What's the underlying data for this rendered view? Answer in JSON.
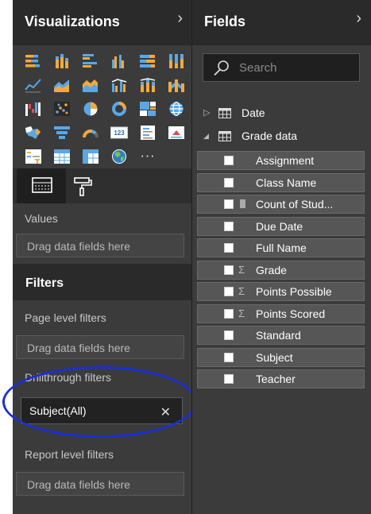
{
  "visualizations": {
    "title": "Visualizations",
    "expand_icon": "chevron-right-icon",
    "more_label": "···",
    "tabs": [
      {
        "name": "fields-tab",
        "icon": "fields-well-icon",
        "selected": true
      },
      {
        "name": "format-tab",
        "icon": "paint-roller-icon",
        "selected": false
      }
    ],
    "values_label": "Values",
    "values_placeholder": "Drag data fields here"
  },
  "filters": {
    "title": "Filters",
    "page_level_label": "Page level filters",
    "page_level_placeholder": "Drag data fields here",
    "drillthrough_label": "Drillthrough filters",
    "drillthrough_filter": {
      "label": "Subject(All)",
      "close_icon": "close-icon"
    },
    "report_level_label": "Report level filters",
    "report_level_placeholder": "Drag data fields here"
  },
  "fields": {
    "title": "Fields",
    "expand_icon": "chevron-right-icon",
    "search_placeholder": "Search",
    "tables": [
      {
        "name": "Date",
        "expanded": false
      },
      {
        "name": "Grade data",
        "expanded": true
      }
    ],
    "items": [
      {
        "name": "Assignment",
        "type": "text"
      },
      {
        "name": "Class Name",
        "type": "text"
      },
      {
        "name": "Count of Stud...",
        "type": "measure"
      },
      {
        "name": "Due Date",
        "type": "text"
      },
      {
        "name": "Full Name",
        "type": "text"
      },
      {
        "name": "Grade",
        "type": "sum"
      },
      {
        "name": "Points Possible",
        "type": "sum"
      },
      {
        "name": "Points Scored",
        "type": "sum"
      },
      {
        "name": "Standard",
        "type": "text"
      },
      {
        "name": "Subject",
        "type": "text"
      },
      {
        "name": "Teacher",
        "type": "text"
      }
    ]
  },
  "colors": {
    "annotation": "#1b2fd6",
    "orange": "#f2a93b",
    "blue": "#5aa7e6",
    "pane_bg": "#3b3b3b"
  }
}
